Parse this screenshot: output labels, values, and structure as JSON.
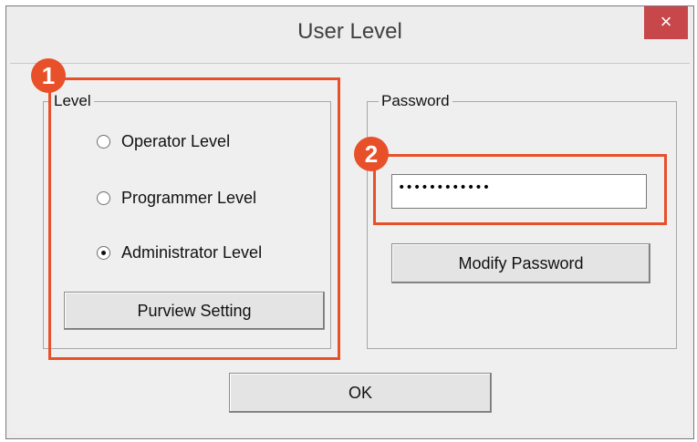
{
  "window": {
    "title": "User Level",
    "close_label": "×"
  },
  "level_group": {
    "label": "Level",
    "options": [
      {
        "label": "Operator Level",
        "selected": false
      },
      {
        "label": "Programmer Level",
        "selected": false
      },
      {
        "label": "Administrator Level",
        "selected": true
      }
    ],
    "purview_button": "Purview Setting"
  },
  "password_group": {
    "label": "Password",
    "password_value": "••••••••••••",
    "modify_button": "Modify Password"
  },
  "ok_button": "OK",
  "annotations": {
    "badge_1": "1",
    "badge_2": "2",
    "highlight_color": "#e8502a"
  }
}
